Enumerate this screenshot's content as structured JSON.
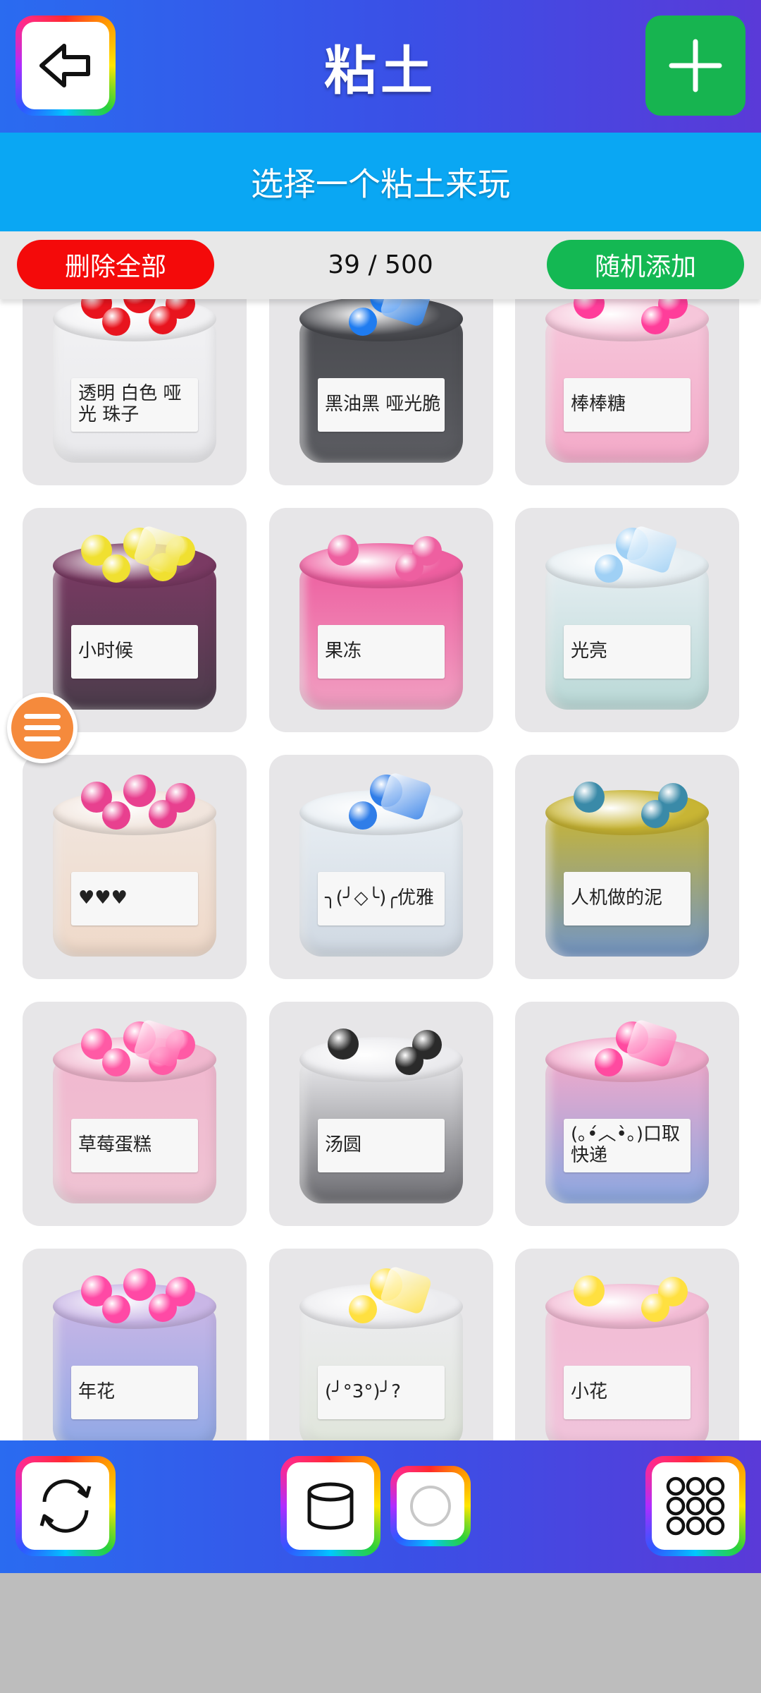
{
  "header": {
    "title": "粘土",
    "back_icon": "back-arrow-icon",
    "add_icon": "plus-icon",
    "add_color": "#17b450"
  },
  "subtitle": "选择一个粘土来玩",
  "actions": {
    "delete_all": "删除全部",
    "count": "39 / 500",
    "random_add": "随机添加",
    "delete_color": "#f40a0a",
    "random_color": "#14b853"
  },
  "slimes": [
    {
      "label": "透明 白色 哑光 珠子",
      "lid": "#f1f1f3",
      "body": "#e9e9ec",
      "accent": "#e8141e"
    },
    {
      "label": "黑油黑 哑光脆",
      "lid": "#4a4b50",
      "body": "#5c5d62",
      "accent": "#1f7cf0"
    },
    {
      "label": "棒棒糖",
      "lid": "#f6c6da",
      "body": "#f3a9c8",
      "accent": "#ff3d9a"
    },
    {
      "label": "小时候",
      "lid": "#7a3a63",
      "body": "#4b3c4b",
      "accent": "#f0e030"
    },
    {
      "label": "果冻",
      "lid": "#ee5fa0",
      "body": "#f0a0c2",
      "accent": "#ee5fa0"
    },
    {
      "label": "光亮",
      "lid": "#e6eef2",
      "body": "#b9d8d6",
      "accent": "#9fd0f5"
    },
    {
      "label": "♥♥♥",
      "lid": "#f1e5dd",
      "body": "#efd9c9",
      "accent": "#e8408f"
    },
    {
      "label": "╮(╯◇╰)╭优雅",
      "lid": "#e8eef3",
      "body": "#cfd8e2",
      "accent": "#2f7de8"
    },
    {
      "label": "人机做的泥",
      "lid": "#c8b534",
      "body": "#7295c5",
      "accent": "#3a8aa8"
    },
    {
      "label": "草莓蛋糕",
      "lid": "#f1b8cf",
      "body": "#efc3d3",
      "accent": "#ff5aa5"
    },
    {
      "label": "汤圆",
      "lid": "#ebebee",
      "body": "#6b6b70",
      "accent": "#2a2a2a"
    },
    {
      "label": "(｡•́︿•̀｡)口取快递",
      "lid": "#f1a9cb",
      "body": "#8aa7e0",
      "accent": "#ff4aa0"
    },
    {
      "label": "年花",
      "lid": "#c9b6e6",
      "body": "#8fa8e6",
      "accent": "#ff49a5"
    },
    {
      "label": "(╯°3°)╯?",
      "lid": "#ececef",
      "body": "#dfe5da",
      "accent": "#ffe040"
    },
    {
      "label": "小花",
      "lid": "#f3bcd5",
      "body": "#f0c4db",
      "accent": "#ffe040"
    }
  ],
  "bottom_bar": {
    "refresh_icon": "refresh-icon",
    "jar_icon": "jar-icon",
    "circle_icon": "circle-icon",
    "grid_icon": "grid-dots-icon"
  },
  "menu_icon": "hamburger-menu-icon",
  "gradient": {
    "start": "#2a6bf0",
    "end": "#5a3ad8"
  },
  "subbar_color": "#0aa7f3"
}
